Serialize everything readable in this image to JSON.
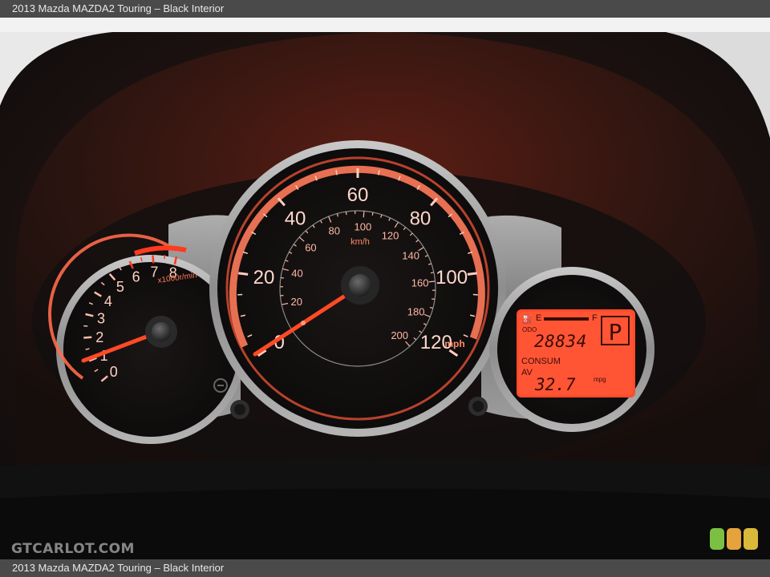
{
  "caption": {
    "top": "2013 Mazda MAZDA2 Touring – Black Interior",
    "bottom": "2013 Mazda MAZDA2 Touring – Black Interior"
  },
  "watermark": "GTCARLOT.COM",
  "badge_colors": [
    "#7cc043",
    "#e6a23c",
    "#d8b93a"
  ],
  "tachometer": {
    "ticks": [
      "0",
      "1",
      "2",
      "3",
      "4",
      "5",
      "6",
      "7",
      "8"
    ],
    "unit": "x1000r/min",
    "reading": 0.8
  },
  "speedometer": {
    "mph_ticks": [
      "0",
      "20",
      "40",
      "60",
      "80",
      "100",
      "120"
    ],
    "mph_unit": "mph",
    "kmh_ticks": [
      "20",
      "40",
      "60",
      "80",
      "100",
      "120",
      "140",
      "160",
      "180",
      "200"
    ],
    "kmh_unit": "km/h",
    "reading_mph": 0
  },
  "display": {
    "fuel_e": "E",
    "fuel_f": "F",
    "odo_label": "ODO",
    "odometer": "28834",
    "gear": "P",
    "consum_label": "CONSUM",
    "av_label": "AV",
    "economy": "32.7",
    "economy_unit": "mpg"
  },
  "colors": {
    "glow": "#ff5a3a",
    "needle": "#ff4a26",
    "lcd": "#ff4b2b",
    "lcd_text": "#3a0c06"
  }
}
